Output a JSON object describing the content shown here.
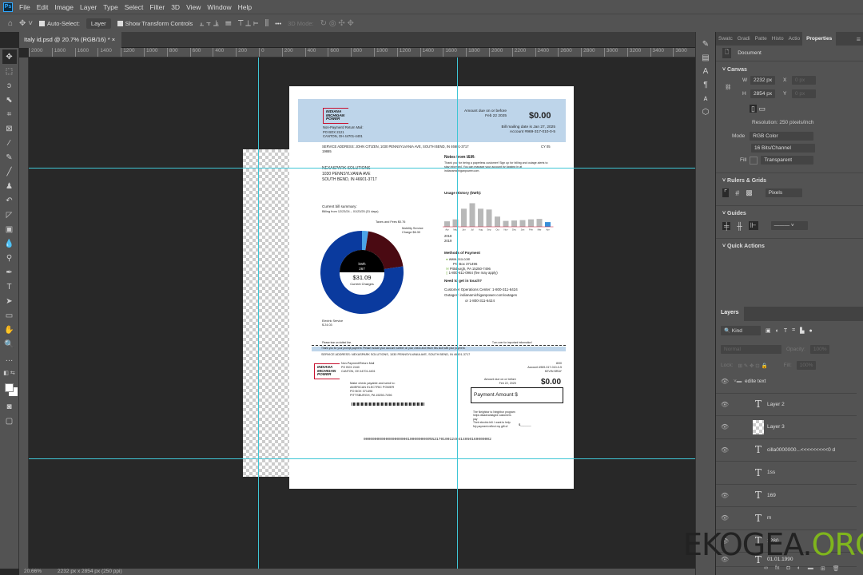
{
  "app": {
    "logo": "Ps",
    "menu": [
      "File",
      "Edit",
      "Image",
      "Layer",
      "Type",
      "Select",
      "Filter",
      "3D",
      "View",
      "Window",
      "Help"
    ]
  },
  "options": {
    "auto_select": "Auto-Select:",
    "layer_select": "Layer",
    "show_transform": "Show Transform Controls",
    "mode3d": "3D Mode:",
    "more": "•••"
  },
  "document_tab": {
    "title": "Italy id.psd @ 20.7% (RGB/16) *",
    "close": "×"
  },
  "ruler_labels": [
    "2000",
    "1800",
    "1600",
    "1400",
    "1200",
    "1000",
    "800",
    "600",
    "400",
    "200",
    "0",
    "200",
    "400",
    "600",
    "800",
    "1000",
    "1200",
    "1400",
    "1600",
    "1800",
    "2000",
    "2200",
    "2400",
    "2600",
    "2800",
    "3000",
    "3200",
    "3400",
    "3600"
  ],
  "status": {
    "zoom": "20.66%",
    "size": "2232 px x 2854 px (250 ppi)"
  },
  "properties": {
    "tabs": [
      "Swatc",
      "Gradi",
      "Patte",
      "Histo",
      "Actio",
      "Properties"
    ],
    "doc_label": "Document",
    "canvas_header": "Canvas",
    "w_label": "W",
    "w": "2232 px",
    "h_label": "H",
    "h": "2854 px",
    "x_label": "X",
    "x": "0 px",
    "y_label": "Y",
    "y": "0 px",
    "resolution": "Resolution: 250 pixels/inch",
    "mode_label": "Mode",
    "mode": "RGB Color",
    "depth": "16 Bits/Channel",
    "fill_label": "Fill",
    "fill": "Transparent",
    "rulers_header": "Rulers & Grids",
    "units": "Pixels",
    "guides_header": "Guides",
    "quick_actions": "Quick Actions"
  },
  "layers": {
    "title": "Layers",
    "kind": "Kind",
    "blend": "Normal",
    "opacity_label": "Opacity:",
    "opacity": "100%",
    "lock_label": "Lock:",
    "fill_label": "Fill:",
    "fill": "100%",
    "items": [
      {
        "name": "edite text",
        "type": "group"
      },
      {
        "name": "Layer 2",
        "type": "text"
      },
      {
        "name": "Layer 3",
        "type": "image"
      },
      {
        "name": "cilla0000000...<<<<<<<<<0 d",
        "type": "text"
      },
      {
        "name": "1ss",
        "type": "text"
      },
      {
        "name": "169",
        "type": "text"
      },
      {
        "name": "m",
        "type": "text"
      },
      {
        "name": "1280",
        "type": "text"
      },
      {
        "name": "01.01.1990",
        "type": "text"
      }
    ]
  },
  "bill": {
    "logo": [
      "INDIANA",
      "MICHIGAN",
      "POWER"
    ],
    "return_mail": [
      "Non-Payment/ Return Mail:",
      "PO BOX 2121",
      "CANTON, OH 44701-4401"
    ],
    "amount_due_label": [
      "Amount due on or before",
      "Feb 22 2025"
    ],
    "amount_due": "$0.00",
    "mailing_date": "Bill mailing date is Jan 27, 2025",
    "account": "Account #969-317-010-0-5",
    "service_address": "SERVICE ADDRESS: JOHN CITIZEN, 1030 PENNSYLVANIA AVE, SOUTH BEND, IN 46601-3717",
    "service_code": "19865",
    "cy": "CY 05",
    "customer": [
      "NEXASPARK SOLUTIONS",
      "1030 PENNSYLVANIA AVE",
      "SOUTH BEND, IN 46601-3717"
    ],
    "notes_title": "Notes from I&M:",
    "notes_text": "Thank you for being a paperless customer! Sign up for billing and outage alerts to stay informed. You can manage your account by logging in at indianamichiganpower.com.",
    "summary_title": "Current bill summary:",
    "billing_period": "Billing from 12/23/24 – 01/23/25 (31 days)",
    "taxes": "Taxes and Fees $0.76",
    "mobility": [
      "Mobility Service",
      "Charge $6.30"
    ],
    "electric": [
      "Electric Service",
      "$ 24.03"
    ],
    "kwh_label": "kWh",
    "kwh": "267",
    "current_charges": "$31.09",
    "current_charges_label": "Current Charges",
    "usage_title": "Usage History (kWh):",
    "years": [
      "2018",
      "2019"
    ],
    "methods_title": "Methods of Payment",
    "methods": [
      "www.pco.com",
      "PO Box 371496",
      "Pittsburgh, PA 15250-7496",
      "1-800-611-0964 (fee may apply)"
    ],
    "contact_title": "Need to get in touch?",
    "contact": [
      "Customer Operations Center: 1-800-311-6424",
      "Outages: indianamichiganpower.com/outages",
      "or 1-800-311-6424"
    ],
    "tear": "Please tear on dotted line.",
    "turn_over": "Turn over for important information!",
    "thanks": "Thank you for your prompt payment. Please include your account number on your check and return this stub with your payment.",
    "service_address2": "SERVICE ADDRESS: NEXASPARK SOLUTIONS, 1030 PENNSYLVANIA AVE, SOUTH BEND, IN 46601-3717",
    "return_mail2": [
      "Non-Payment/Return Mail",
      "PO BOX 2440",
      "CANTON, OH 44701-4401"
    ],
    "stub_right": [
      "8/00",
      "Account #969-317-010-0-5",
      "KEVIN BRAY"
    ],
    "amount_due_label2": [
      "Amount due on or before",
      "Feb 22, 2025"
    ],
    "amount_due2": "$0.00",
    "payable": [
      "Make check payable and send to:",
      "AMERICAN ELECTRIC POWER",
      "PO BOX 371496",
      "PITTSBURGH, PA 15250-7496"
    ],
    "payment_amount": "Payment Amount $",
    "neighbor": [
      "The Neighbor to Neighbor program",
      "helps disadvantaged customers",
      "pay",
      "Their electric bill. I want to help.",
      "My payment reflect my gift of"
    ],
    "gift": "$______",
    "scanline": "000000000000000000001000000000%%31701001240414050169000002"
  },
  "chart_data": {
    "type": "bar",
    "title": "Usage History (kWh):",
    "categories": [
      "Apr",
      "May",
      "Jun",
      "Jul",
      "Aug",
      "Sep",
      "Oct",
      "Nov",
      "Dec",
      "Jan",
      "Feb",
      "Mar",
      "Apr"
    ],
    "values": [
      140,
      190,
      460,
      600,
      460,
      440,
      260,
      150,
      160,
      170,
      190,
      200,
      120
    ],
    "highlight_index": 12,
    "colors": {
      "bar": "#b8b8b8",
      "current": "#3a8fd9",
      "baseline": "#c8102e"
    }
  },
  "donut": {
    "values": [
      0.76,
      6.3,
      24.03
    ],
    "colors": [
      "#4aa3e8",
      "#4a0a12",
      "#0a3a9e"
    ]
  },
  "watermark": {
    "text": "EKOGEA.",
    "org": "ORG"
  }
}
